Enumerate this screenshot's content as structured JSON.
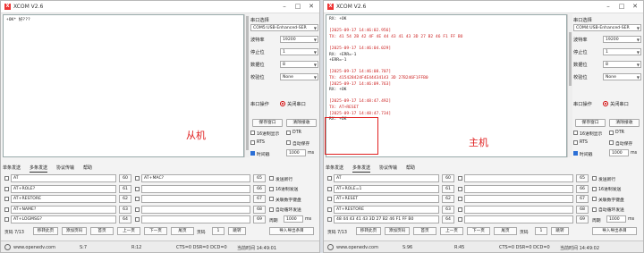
{
  "left_window": {
    "title": "XCOM V2.6",
    "receive_lines": [
      {
        "text": "+OK* 好???",
        "cls": "c-rx"
      }
    ],
    "settings": {
      "port_label": "串口选择",
      "port_value": "COM5:USB-Enhanced-SER",
      "baud_label": "波特率",
      "baud_value": "19200",
      "stop_label": "停止位",
      "stop_value": "1",
      "data_label": "数据位",
      "data_value": "8",
      "parity_label": "校验位",
      "parity_value": "None",
      "op_label": "串口操作",
      "op_button": "关闭串口",
      "save_window": "保存窗口",
      "clear_recv": "清除接收",
      "hex_display": "16进制显示",
      "dtr": "DTR",
      "rts": "RTS",
      "auto_save": "自动保存",
      "timestamp": "时间戳",
      "timestamp_ms": "1000",
      "ms_unit": "ms"
    },
    "tabs": [
      "单条发送",
      "多条发送",
      "协议传输",
      "帮助"
    ],
    "multi_rows_left": [
      {
        "text": "AT",
        "num": "60"
      },
      {
        "text": "AT+ROLE?",
        "num": "61"
      },
      {
        "text": "AT+RESTORE",
        "num": "62"
      },
      {
        "text": "AT+NAME?",
        "num": "63"
      },
      {
        "text": "AT+LOGMSG?",
        "num": "64"
      }
    ],
    "multi_rows_mid": [
      {
        "text": "AT+MAC?",
        "num": "65"
      },
      {
        "text": "",
        "num": "66"
      },
      {
        "text": "",
        "num": "67"
      },
      {
        "text": "",
        "num": "68"
      },
      {
        "text": "",
        "num": "69"
      }
    ],
    "options": {
      "send_newline": "发送新行",
      "hex_send": "16进制发送",
      "close_num_kbd": "关联数字键盘",
      "auto_loop": "自动循环发送",
      "period_label": "周期",
      "period_value": "1000",
      "ms": "ms"
    },
    "pager": {
      "page": "页码 7/13",
      "move": "移转此页",
      "add_page": "添加页码",
      "first": "首页",
      "prev": "上一页",
      "next": "下一页",
      "last": "尾页",
      "page_no_label": "页码",
      "page_no": "1",
      "jump": "跳转",
      "import": "导入导出条目"
    },
    "status": {
      "url": "www.openedv.com",
      "s": "S:7",
      "r": "R:12",
      "lines": "CTS=0 DSR=0 DCD=0",
      "time": "当前时间 14:49:01"
    }
  },
  "right_window": {
    "title": "XCOM V2.6",
    "receive_lines": [
      {
        "text": "RX: +OK",
        "cls": "c-rx"
      },
      {
        "text": "",
        "cls": "c-rx"
      },
      {
        "text": "[2025-09-17 14:46:02.956]",
        "cls": "c-ts"
      },
      {
        "text": "TX: 41 54 2B 42 4F 4E 44 43 41 43 3D 27 B2 46 F1 FF BO",
        "cls": "c-ts"
      },
      {
        "text": "",
        "cls": "c-rx"
      },
      {
        "text": "[2025-09-17 14:46:04.029]",
        "cls": "c-ts"
      },
      {
        "text": "RX: +ERR=-1",
        "cls": "c-rx"
      },
      {
        "text": "+ERR=-1",
        "cls": "c-rx"
      },
      {
        "text": "",
        "cls": "c-rx"
      },
      {
        "text": "[2025-09-17 14:46:08.707]",
        "cls": "c-ts"
      },
      {
        "text": "TX: 415428424F4E44434143 3D 27B246F1FFB0",
        "cls": "c-ts"
      },
      {
        "text": "[2025-09-17 14:46:09.763]",
        "cls": "c-ts"
      },
      {
        "text": "RX: +OK",
        "cls": "c-rx"
      },
      {
        "text": "",
        "cls": "c-rx"
      },
      {
        "text": "[2025-09-17 14:48:47.492]",
        "cls": "c-ts"
      },
      {
        "text": "TX: AT+RESET",
        "cls": "c-ts"
      },
      {
        "text": "[2025-09-17 14:48:47.734]",
        "cls": "c-ts"
      },
      {
        "text": "RX: +OK",
        "cls": "c-rx"
      }
    ],
    "settings": {
      "port_label": "串口选择",
      "port_value": "COM4:USB-Enhanced-SER",
      "baud_label": "波特率",
      "baud_value": "19200",
      "stop_label": "停止位",
      "stop_value": "1",
      "data_label": "数据位",
      "data_value": "8",
      "parity_label": "校验位",
      "parity_value": "None",
      "op_label": "串口操作",
      "op_button": "关闭串口",
      "save_window": "保存窗口",
      "clear_recv": "清除接收",
      "hex_display": "16进制显示",
      "dtr": "DTR",
      "rts": "RTS",
      "auto_save": "自动保存",
      "timestamp": "时间戳",
      "timestamp_ms": "1000",
      "ms_unit": "ms"
    },
    "tabs": [
      "单条发送",
      "多条发送",
      "协议传输",
      "帮助"
    ],
    "multi_rows_left": [
      {
        "text": "AT",
        "num": "60"
      },
      {
        "text": "AT+ROLE=1",
        "num": "61"
      },
      {
        "text": "AT+RESET",
        "num": "62"
      },
      {
        "text": "AT+RESTORE",
        "num": "63"
      },
      {
        "text": "48 44 43 41 43 3D 27 B2 46 F1 FF B0",
        "num": "64"
      }
    ],
    "multi_rows_mid": [
      {
        "text": "",
        "num": "65"
      },
      {
        "text": "",
        "num": "66"
      },
      {
        "text": "",
        "num": "67"
      },
      {
        "text": "",
        "num": "68"
      },
      {
        "text": "",
        "num": "69"
      }
    ],
    "options": {
      "send_newline": "发送新行",
      "hex_send": "16进制发送",
      "close_num_kbd": "关联数字键盘",
      "auto_loop": "自动循环发送",
      "period_label": "周期",
      "period_value": "1000",
      "ms": "ms"
    },
    "pager": {
      "page": "页码 7/13",
      "move": "移转此页",
      "add_page": "添加页码",
      "first": "首页",
      "prev": "上一页",
      "next": "下一页",
      "last": "尾页",
      "page_no_label": "页码",
      "page_no": "1",
      "jump": "跳转",
      "import": "导入导出条目"
    },
    "status": {
      "url": "www.openedv.com",
      "s": "S:96",
      "r": "R:45",
      "lines": "CTS=0 DSR=0 DCD=0",
      "time": "当前时间 14:49:02"
    }
  },
  "annotations": {
    "slave": "从机",
    "master": "主机"
  },
  "colors": {
    "accent": "#2b6fd6",
    "timestamp_text": "#cc2222",
    "annotation": "#e02020"
  }
}
